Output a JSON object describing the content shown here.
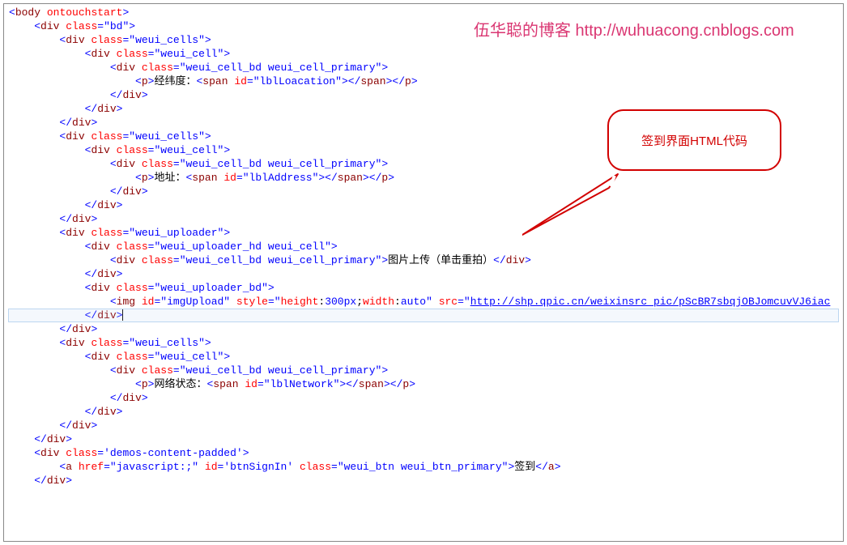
{
  "watermark": "伍华聪的博客 http://wuhuacong.cnblogs.com",
  "callout": {
    "text": "签到界面HTML代码"
  },
  "code": {
    "lines": [
      [
        [
          "<",
          "blue"
        ],
        [
          "body",
          "brown"
        ],
        [
          " ",
          "black"
        ],
        [
          "ontouchstart",
          "strred"
        ],
        [
          ">",
          "blue"
        ]
      ],
      [
        [
          "    ",
          "black"
        ],
        [
          "<",
          "blue"
        ],
        [
          "div",
          "brown"
        ],
        [
          " ",
          "black"
        ],
        [
          "class",
          "strred"
        ],
        [
          "=",
          "blue"
        ],
        [
          "\"bd\"",
          "blue"
        ],
        [
          ">",
          "blue"
        ]
      ],
      [
        [
          "        ",
          "black"
        ],
        [
          "<",
          "blue"
        ],
        [
          "div",
          "brown"
        ],
        [
          " ",
          "black"
        ],
        [
          "class",
          "strred"
        ],
        [
          "=",
          "blue"
        ],
        [
          "\"weui_cells\"",
          "blue"
        ],
        [
          ">",
          "blue"
        ]
      ],
      [
        [
          "            ",
          "black"
        ],
        [
          "<",
          "blue"
        ],
        [
          "div",
          "brown"
        ],
        [
          " ",
          "black"
        ],
        [
          "class",
          "strred"
        ],
        [
          "=",
          "blue"
        ],
        [
          "\"weui_cell\"",
          "blue"
        ],
        [
          ">",
          "blue"
        ]
      ],
      [
        [
          "                ",
          "black"
        ],
        [
          "<",
          "blue"
        ],
        [
          "div",
          "brown"
        ],
        [
          " ",
          "black"
        ],
        [
          "class",
          "strred"
        ],
        [
          "=",
          "blue"
        ],
        [
          "\"weui_cell_bd weui_cell_primary\"",
          "blue"
        ],
        [
          ">",
          "blue"
        ]
      ],
      [
        [
          "                    ",
          "black"
        ],
        [
          "<",
          "blue"
        ],
        [
          "p",
          "brown"
        ],
        [
          ">",
          "blue"
        ],
        [
          "经纬度：",
          "black"
        ],
        [
          "<",
          "blue"
        ],
        [
          "span",
          "brown"
        ],
        [
          " ",
          "black"
        ],
        [
          "id",
          "strred"
        ],
        [
          "=",
          "blue"
        ],
        [
          "\"lblLoacation\"",
          "blue"
        ],
        [
          "></",
          "blue"
        ],
        [
          "span",
          "brown"
        ],
        [
          "></",
          "blue"
        ],
        [
          "p",
          "brown"
        ],
        [
          ">",
          "blue"
        ]
      ],
      [
        [
          "                ",
          "black"
        ],
        [
          "</",
          "blue"
        ],
        [
          "div",
          "brown"
        ],
        [
          ">",
          "blue"
        ]
      ],
      [
        [
          "            ",
          "black"
        ],
        [
          "</",
          "blue"
        ],
        [
          "div",
          "brown"
        ],
        [
          ">",
          "blue"
        ]
      ],
      [
        [
          "        ",
          "black"
        ],
        [
          "</",
          "blue"
        ],
        [
          "div",
          "brown"
        ],
        [
          ">",
          "blue"
        ]
      ],
      [
        [
          "        ",
          "black"
        ],
        [
          "<",
          "blue"
        ],
        [
          "div",
          "brown"
        ],
        [
          " ",
          "black"
        ],
        [
          "class",
          "strred"
        ],
        [
          "=",
          "blue"
        ],
        [
          "\"weui_cells\"",
          "blue"
        ],
        [
          ">",
          "blue"
        ]
      ],
      [
        [
          "            ",
          "black"
        ],
        [
          "<",
          "blue"
        ],
        [
          "div",
          "brown"
        ],
        [
          " ",
          "black"
        ],
        [
          "class",
          "strred"
        ],
        [
          "=",
          "blue"
        ],
        [
          "\"weui_cell\"",
          "blue"
        ],
        [
          ">",
          "blue"
        ]
      ],
      [
        [
          "                ",
          "black"
        ],
        [
          "<",
          "blue"
        ],
        [
          "div",
          "brown"
        ],
        [
          " ",
          "black"
        ],
        [
          "class",
          "strred"
        ],
        [
          "=",
          "blue"
        ],
        [
          "\"weui_cell_bd weui_cell_primary\"",
          "blue"
        ],
        [
          ">",
          "blue"
        ]
      ],
      [
        [
          "                    ",
          "black"
        ],
        [
          "<",
          "blue"
        ],
        [
          "p",
          "brown"
        ],
        [
          ">",
          "blue"
        ],
        [
          "地址：",
          "black"
        ],
        [
          "<",
          "blue"
        ],
        [
          "span",
          "brown"
        ],
        [
          " ",
          "black"
        ],
        [
          "id",
          "strred"
        ],
        [
          "=",
          "blue"
        ],
        [
          "\"lblAddress\"",
          "blue"
        ],
        [
          "></",
          "blue"
        ],
        [
          "span",
          "brown"
        ],
        [
          "></",
          "blue"
        ],
        [
          "p",
          "brown"
        ],
        [
          ">",
          "blue"
        ]
      ],
      [
        [
          "                ",
          "black"
        ],
        [
          "</",
          "blue"
        ],
        [
          "div",
          "brown"
        ],
        [
          ">",
          "blue"
        ]
      ],
      [
        [
          "            ",
          "black"
        ],
        [
          "</",
          "blue"
        ],
        [
          "div",
          "brown"
        ],
        [
          ">",
          "blue"
        ]
      ],
      [
        [
          "        ",
          "black"
        ],
        [
          "</",
          "blue"
        ],
        [
          "div",
          "brown"
        ],
        [
          ">",
          "blue"
        ]
      ],
      [
        [
          "        ",
          "black"
        ],
        [
          "<",
          "blue"
        ],
        [
          "div",
          "brown"
        ],
        [
          " ",
          "black"
        ],
        [
          "class",
          "strred"
        ],
        [
          "=",
          "blue"
        ],
        [
          "\"weui_uploader\"",
          "blue"
        ],
        [
          ">",
          "blue"
        ]
      ],
      [
        [
          "            ",
          "black"
        ],
        [
          "<",
          "blue"
        ],
        [
          "div",
          "brown"
        ],
        [
          " ",
          "black"
        ],
        [
          "class",
          "strred"
        ],
        [
          "=",
          "blue"
        ],
        [
          "\"weui_uploader_hd weui_cell\"",
          "blue"
        ],
        [
          ">",
          "blue"
        ]
      ],
      [
        [
          "                ",
          "black"
        ],
        [
          "<",
          "blue"
        ],
        [
          "div",
          "brown"
        ],
        [
          " ",
          "black"
        ],
        [
          "class",
          "strred"
        ],
        [
          "=",
          "blue"
        ],
        [
          "\"weui_cell_bd weui_cell_primary\"",
          "blue"
        ],
        [
          ">",
          "blue"
        ],
        [
          "图片上传（单击重拍）",
          "black"
        ],
        [
          "</",
          "blue"
        ],
        [
          "div",
          "brown"
        ],
        [
          ">",
          "blue"
        ]
      ],
      [
        [
          "            ",
          "black"
        ],
        [
          "</",
          "blue"
        ],
        [
          "div",
          "brown"
        ],
        [
          ">",
          "blue"
        ]
      ],
      [
        [
          "            ",
          "black"
        ],
        [
          "<",
          "blue"
        ],
        [
          "div",
          "brown"
        ],
        [
          " ",
          "black"
        ],
        [
          "class",
          "strred"
        ],
        [
          "=",
          "blue"
        ],
        [
          "\"weui_uploader_bd\"",
          "blue"
        ],
        [
          ">",
          "blue"
        ]
      ],
      [
        [
          "                ",
          "black"
        ],
        [
          "<",
          "blue"
        ],
        [
          "img",
          "brown"
        ],
        [
          " ",
          "black"
        ],
        [
          "id",
          "strred"
        ],
        [
          "=",
          "blue"
        ],
        [
          "\"imgUpload\"",
          "blue"
        ],
        [
          " ",
          "black"
        ],
        [
          "style",
          "strred"
        ],
        [
          "=",
          "blue"
        ],
        [
          "\"",
          "blue"
        ],
        [
          "height",
          "strred"
        ],
        [
          ":",
          "black"
        ],
        [
          "300px",
          "blue"
        ],
        [
          ";",
          "black"
        ],
        [
          "width",
          "strred"
        ],
        [
          ":",
          "black"
        ],
        [
          "auto",
          "blue"
        ],
        [
          "\"",
          "blue"
        ],
        [
          " ",
          "black"
        ],
        [
          "src",
          "strred"
        ],
        [
          "=",
          "blue"
        ],
        [
          "\"",
          "blue"
        ],
        [
          "http://shp.qpic.cn/weixinsrc_pic/pScBR7sbqjOBJomcuvVJ6iac",
          "blue",
          "underline"
        ]
      ],
      [
        [
          "            ",
          "black"
        ],
        [
          "</",
          "blue"
        ],
        [
          "div",
          "brown"
        ],
        [
          ">",
          "blue"
        ],
        [
          "__CARET__",
          ""
        ]
      ],
      [
        [
          "        ",
          "black"
        ],
        [
          "</",
          "blue"
        ],
        [
          "div",
          "brown"
        ],
        [
          ">",
          "blue"
        ]
      ],
      [
        [
          "        ",
          "black"
        ],
        [
          "<",
          "blue"
        ],
        [
          "div",
          "brown"
        ],
        [
          " ",
          "black"
        ],
        [
          "class",
          "strred"
        ],
        [
          "=",
          "blue"
        ],
        [
          "\"weui_cells\"",
          "blue"
        ],
        [
          ">",
          "blue"
        ]
      ],
      [
        [
          "            ",
          "black"
        ],
        [
          "<",
          "blue"
        ],
        [
          "div",
          "brown"
        ],
        [
          " ",
          "black"
        ],
        [
          "class",
          "strred"
        ],
        [
          "=",
          "blue"
        ],
        [
          "\"weui_cell\"",
          "blue"
        ],
        [
          ">",
          "blue"
        ]
      ],
      [
        [
          "                ",
          "black"
        ],
        [
          "<",
          "blue"
        ],
        [
          "div",
          "brown"
        ],
        [
          " ",
          "black"
        ],
        [
          "class",
          "strred"
        ],
        [
          "=",
          "blue"
        ],
        [
          "\"weui_cell_bd weui_cell_primary\"",
          "blue"
        ],
        [
          ">",
          "blue"
        ]
      ],
      [
        [
          "                    ",
          "black"
        ],
        [
          "<",
          "blue"
        ],
        [
          "p",
          "brown"
        ],
        [
          ">",
          "blue"
        ],
        [
          "网络状态：",
          "black"
        ],
        [
          "<",
          "blue"
        ],
        [
          "span",
          "brown"
        ],
        [
          " ",
          "black"
        ],
        [
          "id",
          "strred"
        ],
        [
          "=",
          "blue"
        ],
        [
          "\"lblNetwork\"",
          "blue"
        ],
        [
          "></",
          "blue"
        ],
        [
          "span",
          "brown"
        ],
        [
          "></",
          "blue"
        ],
        [
          "p",
          "brown"
        ],
        [
          ">",
          "blue"
        ]
      ],
      [
        [
          "                ",
          "black"
        ],
        [
          "</",
          "blue"
        ],
        [
          "div",
          "brown"
        ],
        [
          ">",
          "blue"
        ]
      ],
      [
        [
          "            ",
          "black"
        ],
        [
          "</",
          "blue"
        ],
        [
          "div",
          "brown"
        ],
        [
          ">",
          "blue"
        ]
      ],
      [
        [
          "        ",
          "black"
        ],
        [
          "</",
          "blue"
        ],
        [
          "div",
          "brown"
        ],
        [
          ">",
          "blue"
        ]
      ],
      [
        [
          "    ",
          "black"
        ],
        [
          "</",
          "blue"
        ],
        [
          "div",
          "brown"
        ],
        [
          ">",
          "blue"
        ]
      ],
      [
        [
          "    ",
          "black"
        ],
        [
          "<",
          "blue"
        ],
        [
          "div",
          "brown"
        ],
        [
          " ",
          "black"
        ],
        [
          "class",
          "strred"
        ],
        [
          "=",
          "blue"
        ],
        [
          "'demos-content-padded'",
          "blue"
        ],
        [
          ">",
          "blue"
        ]
      ],
      [
        [
          "        ",
          "black"
        ],
        [
          "<",
          "blue"
        ],
        [
          "a",
          "brown"
        ],
        [
          " ",
          "black"
        ],
        [
          "href",
          "strred"
        ],
        [
          "=",
          "blue"
        ],
        [
          "\"javascript:;\"",
          "blue"
        ],
        [
          " ",
          "black"
        ],
        [
          "id",
          "strred"
        ],
        [
          "=",
          "blue"
        ],
        [
          "'btnSignIn'",
          "blue"
        ],
        [
          " ",
          "black"
        ],
        [
          "class",
          "strred"
        ],
        [
          "=",
          "blue"
        ],
        [
          "\"weui_btn weui_btn_primary\"",
          "blue"
        ],
        [
          ">",
          "blue"
        ],
        [
          "签到",
          "black"
        ],
        [
          "</",
          "blue"
        ],
        [
          "a",
          "brown"
        ],
        [
          ">",
          "blue"
        ]
      ],
      [
        [
          "    ",
          "black"
        ],
        [
          "</",
          "blue"
        ],
        [
          "div",
          "brown"
        ],
        [
          ">",
          "blue"
        ]
      ]
    ],
    "highlightLine": 22
  }
}
